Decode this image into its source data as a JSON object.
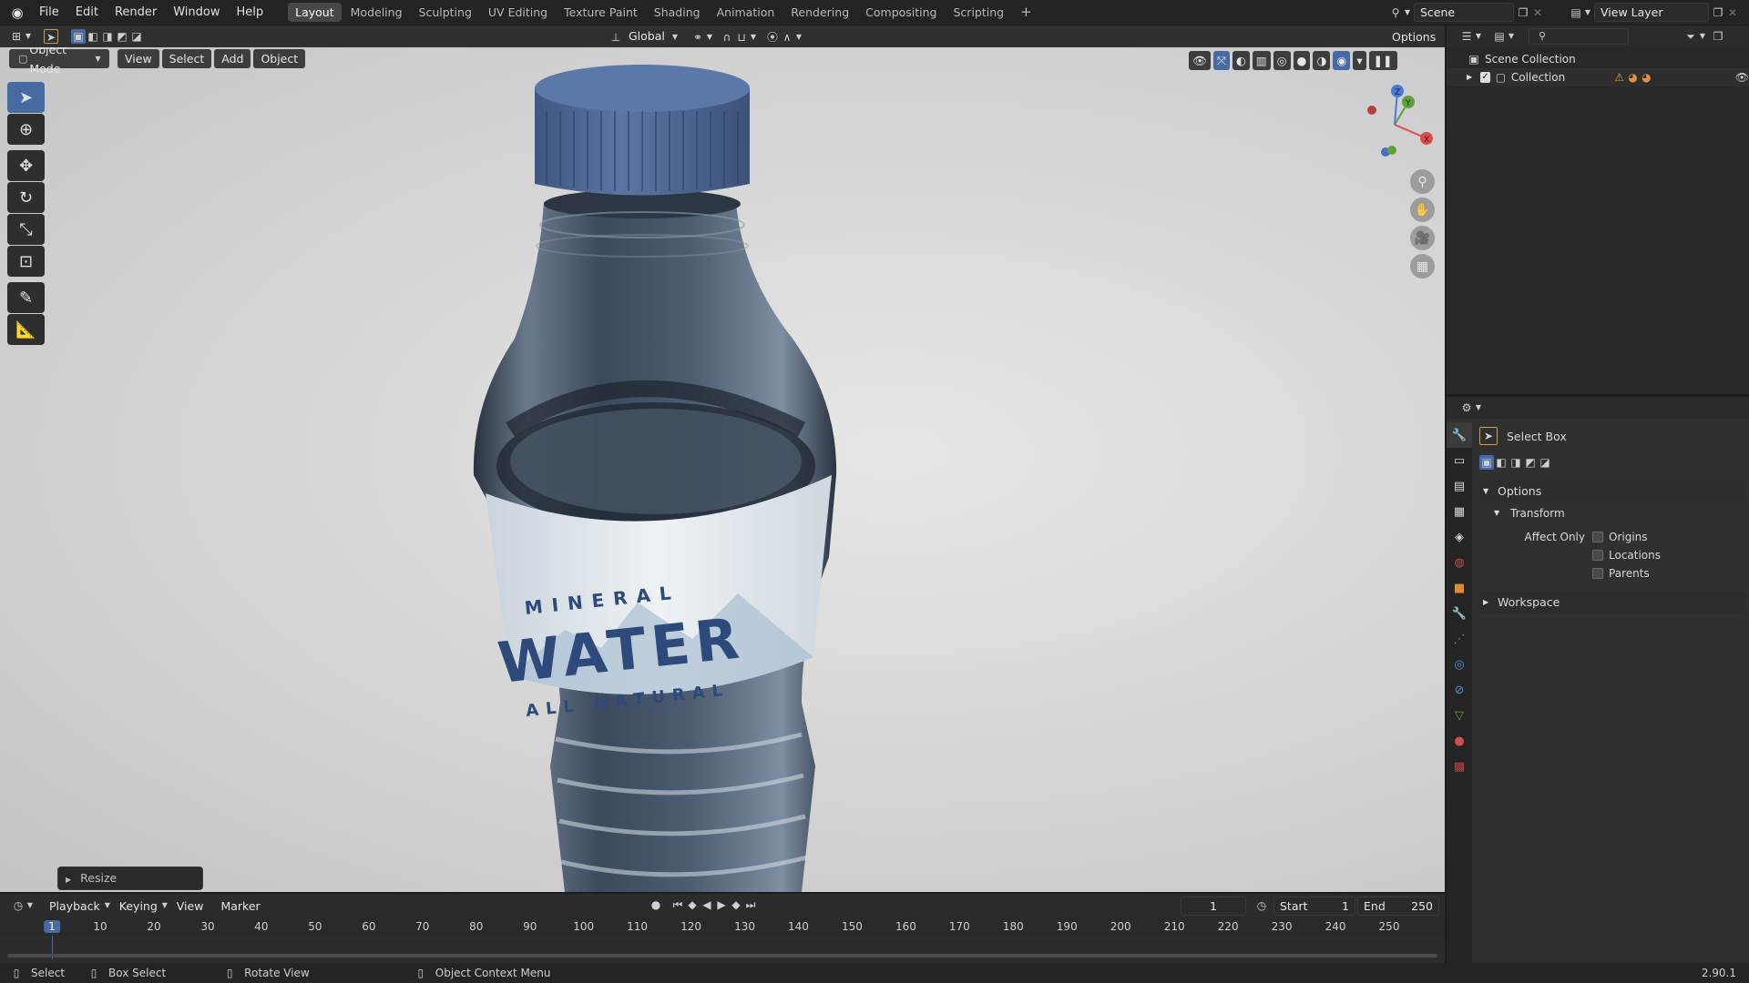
{
  "top_bar": {
    "menus": [
      "File",
      "Edit",
      "Render",
      "Window",
      "Help"
    ],
    "workspace_tabs": [
      "Layout",
      "Modeling",
      "Sculpting",
      "UV Editing",
      "Texture Paint",
      "Shading",
      "Animation",
      "Rendering",
      "Compositing",
      "Scripting"
    ],
    "active_tab": "Layout",
    "add_tab": "+",
    "scene": "Scene",
    "view_layer": "View Layer"
  },
  "tool_header": {
    "orientation": "Global",
    "options": "Options"
  },
  "viewport_header": {
    "mode": "Object Mode",
    "menus": [
      "View",
      "Select",
      "Add",
      "Object"
    ]
  },
  "viewport": {
    "resize_panel": "Resize",
    "label_text": {
      "line1": "MINERAL",
      "line2": "WATER",
      "line3": "ALL NATURAL"
    },
    "axis_labels": {
      "x": "X",
      "y": "Y",
      "z": "Z"
    }
  },
  "outliner": {
    "search_placeholder": "",
    "scene_collection": "Scene Collection",
    "collection": "Collection"
  },
  "properties": {
    "tool_name": "Select Box",
    "options_label": "Options",
    "transform_label": "Transform",
    "affect_only_label": "Affect Only",
    "affect_only_items": [
      "Origins",
      "Locations",
      "Parents"
    ],
    "workspace_label": "Workspace"
  },
  "timeline": {
    "menus": [
      "Playback",
      "Keying",
      "View",
      "Marker"
    ],
    "current_frame": "1",
    "start_label": "Start",
    "start_value": "1",
    "end_label": "End",
    "end_value": "250",
    "ruler_ticks": [
      "1",
      "10",
      "20",
      "30",
      "40",
      "50",
      "60",
      "70",
      "80",
      "90",
      "100",
      "110",
      "120",
      "130",
      "140",
      "150",
      "160",
      "170",
      "180",
      "190",
      "200",
      "210",
      "220",
      "230",
      "240",
      "250"
    ]
  },
  "status_bar": {
    "select": "Select",
    "box_select": "Box Select",
    "rotate_view": "Rotate View",
    "context_menu": "Object Context Menu",
    "version": "2.90.1"
  },
  "colors": {
    "accent": "#476aa3",
    "active_tab_bg": "#474747",
    "cap": "#4e6c9a"
  }
}
